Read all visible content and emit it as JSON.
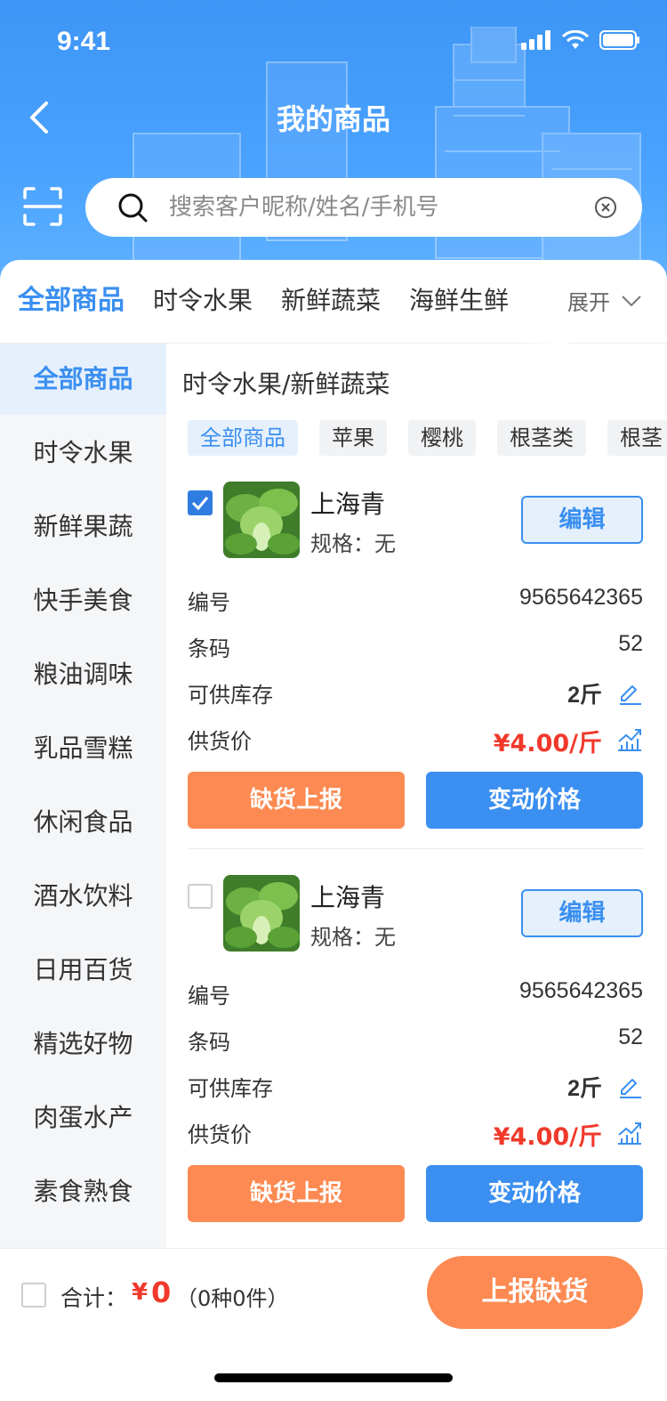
{
  "status_bar": {
    "time": "9:41"
  },
  "header": {
    "title": "我的商品",
    "search_placeholder": "搜索客户昵称/姓名/手机号"
  },
  "top_tabs": {
    "items": [
      "全部商品",
      "时令水果",
      "新鲜蔬菜",
      "海鲜生鲜"
    ],
    "active_index": 0,
    "expand_label": "展开"
  },
  "sidebar": {
    "items": [
      "全部商品",
      "时令水果",
      "新鲜果蔬",
      "快手美食",
      "粮油调味",
      "乳品雪糕",
      "休闲食品",
      "酒水饮料",
      "日用百货",
      "精选好物",
      "肉蛋水产",
      "素食熟食"
    ],
    "active_index": 0
  },
  "content": {
    "breadcrumb": "时令水果/新鲜蔬菜",
    "chips": [
      "全部商品",
      "苹果",
      "樱桃",
      "根茎类",
      "根茎"
    ],
    "products": [
      {
        "checked": true,
        "name": "上海青",
        "spec": "规格：无",
        "edit_label": "编辑",
        "code_label": "编号",
        "code": "9565642365",
        "barcode_label": "条码",
        "barcode": "52",
        "stock_label": "可供库存",
        "stock": "2斤",
        "price_label": "供货价",
        "price": "¥4.00/斤",
        "report_label": "缺货上报",
        "change_price_label": "变动价格"
      },
      {
        "checked": false,
        "name": "上海青",
        "spec": "规格：无",
        "edit_label": "编辑",
        "code_label": "编号",
        "code": "9565642365",
        "barcode_label": "条码",
        "barcode": "52",
        "stock_label": "可供库存",
        "stock": "2斤",
        "price_label": "供货价",
        "price": "¥4.00/斤",
        "report_label": "缺货上报",
        "change_price_label": "变动价格"
      }
    ]
  },
  "bottom_bar": {
    "total_label": "合计：",
    "currency": "¥",
    "amount": "0",
    "count": "（0种0件）",
    "submit_label": "上报缺货"
  },
  "colors": {
    "primary": "#3a8ff0",
    "orange": "#fc8a52",
    "price_red": "#f0392b",
    "header_blue": "#3d95f5"
  },
  "icons": [
    "back-icon",
    "scan-icon",
    "search-icon",
    "clear-icon",
    "chevron-down-icon",
    "edit-pencil-icon",
    "chart-trend-icon",
    "checkbox-icon"
  ]
}
